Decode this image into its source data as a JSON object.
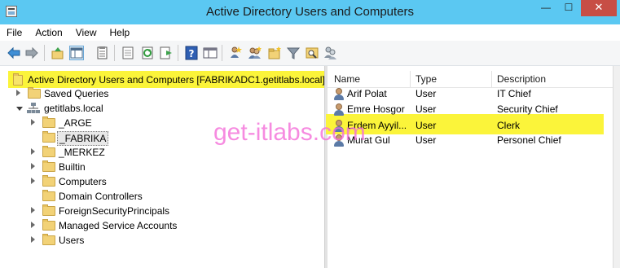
{
  "window": {
    "title": "Active Directory Users and Computers",
    "minimize": "—",
    "maximize": "☐",
    "close": "✕"
  },
  "menu": [
    "File",
    "Action",
    "View",
    "Help"
  ],
  "toolbar_icons": [
    "back-icon",
    "forward-icon",
    "up-level-icon",
    "show-hide-console-tree-icon",
    "properties-icon",
    "export-list-icon",
    "refresh-icon",
    "export-icon",
    "help-icon",
    "console-tree-icon",
    "new-user-icon",
    "new-group-icon",
    "new-ou-icon",
    "filter-icon",
    "find-icon",
    "add-to-group-icon"
  ],
  "tree": {
    "root": "Active Directory Users and Computers [FABRIKADC1.getitlabs.local]",
    "saved_queries": "Saved Queries",
    "domain": "getitlabs.local",
    "children": [
      "_ARGE",
      "_FABRIKA",
      "_MERKEZ",
      "Builtin",
      "Computers",
      "Domain Controllers",
      "ForeignSecurityPrincipals",
      "Managed Service Accounts",
      "Users"
    ]
  },
  "list": {
    "columns": [
      "Name",
      "Type",
      "Description"
    ],
    "rows": [
      {
        "name": "Arif Polat",
        "type": "User",
        "description": "IT Chief"
      },
      {
        "name": "Emre Hosgor",
        "type": "User",
        "description": "Security Chief"
      },
      {
        "name": "Erdem Ayyil...",
        "type": "User",
        "description": "Clerk"
      },
      {
        "name": "Murat Gul",
        "type": "User",
        "description": "Personel Chief"
      }
    ]
  },
  "watermark": "get-itlabs.com",
  "colors": {
    "titlebar": "#5bc8f2",
    "highlight": "#fbf43a",
    "watermark": "#f56fd9",
    "close_button": "#c74e45"
  }
}
